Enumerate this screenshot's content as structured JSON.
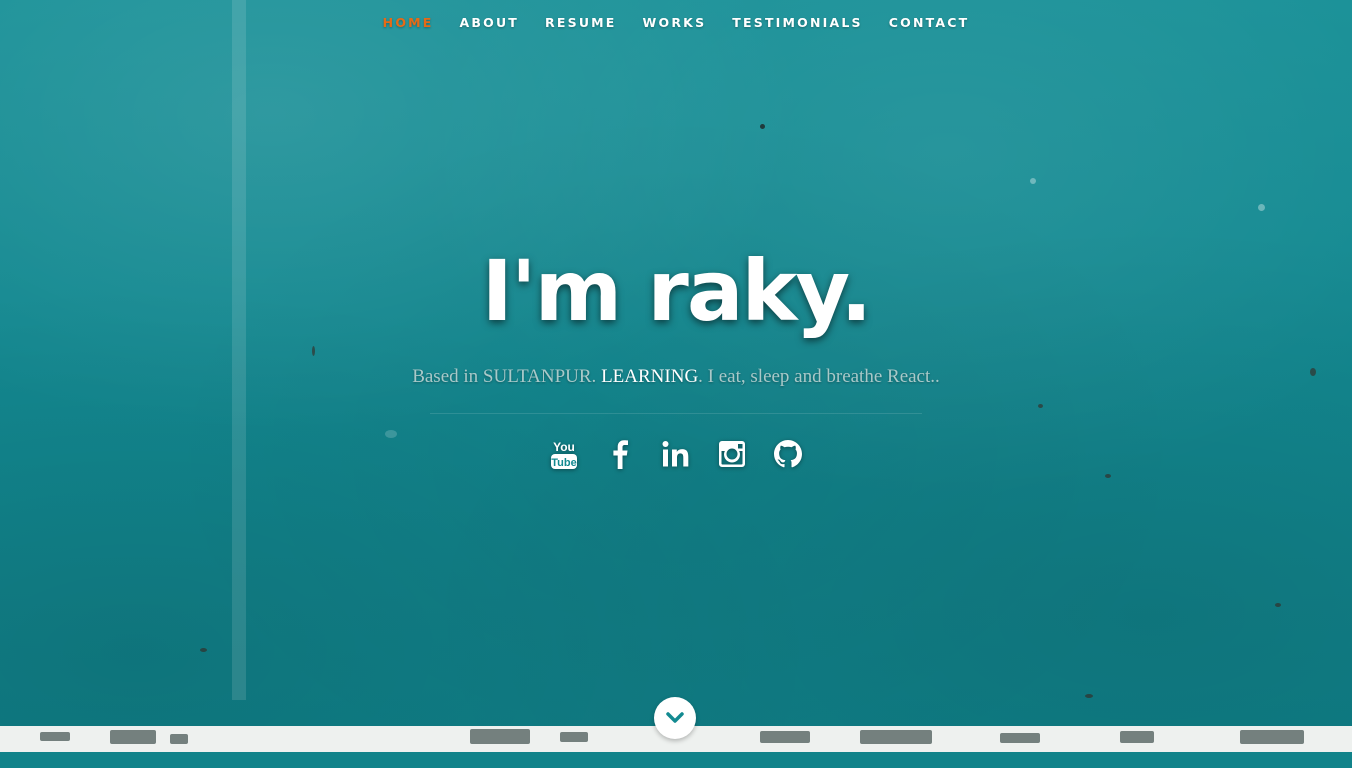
{
  "nav": {
    "items": [
      {
        "label": "HOME",
        "active": true
      },
      {
        "label": "ABOUT",
        "active": false
      },
      {
        "label": "RESUME",
        "active": false
      },
      {
        "label": "WORKS",
        "active": false
      },
      {
        "label": "TESTIMONIALS",
        "active": false
      },
      {
        "label": "CONTACT",
        "active": false
      }
    ]
  },
  "hero": {
    "title": "I'm raky.",
    "sub_prefix": "Based in SULTANPUR. ",
    "sub_highlight": "LEARNING",
    "sub_suffix": ". I eat, sleep and breathe React.."
  },
  "social": [
    {
      "icon": "youtube-icon"
    },
    {
      "icon": "facebook-icon"
    },
    {
      "icon": "linkedin-icon"
    },
    {
      "icon": "instagram-icon"
    },
    {
      "icon": "github-icon"
    }
  ],
  "colors": {
    "background": "#138a91",
    "accent_active_nav": "#e66a16",
    "text": "#ffffff",
    "subtitle": "#a9c9c9"
  }
}
